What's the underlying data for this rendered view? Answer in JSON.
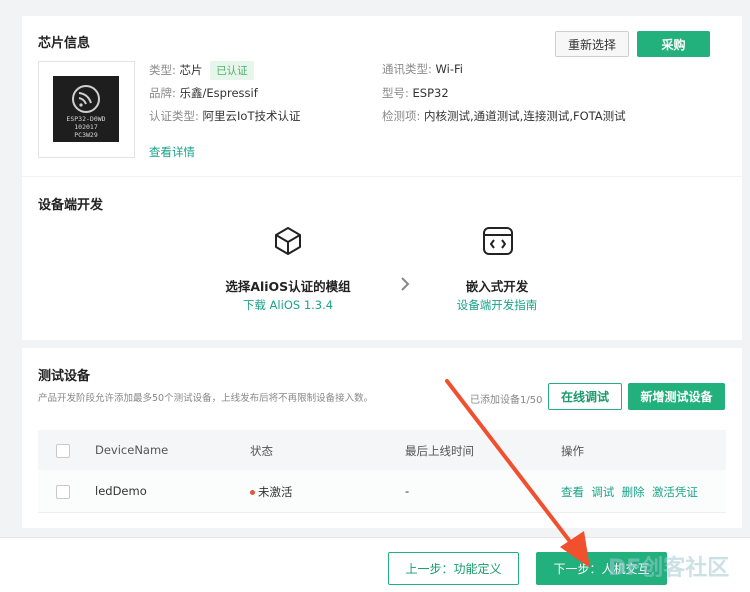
{
  "chip_info": {
    "title": "芯片信息",
    "buttons": {
      "reselect": "重新选择",
      "purchase": "采购"
    },
    "image_label_lines": [
      "ESP32-D0WD",
      "102017",
      "PC3W29"
    ],
    "fields": {
      "type_label": "类型:",
      "type_value": "芯片",
      "certified_badge": "已认证",
      "brand_label": "品牌:",
      "brand_value": "乐鑫/Espressif",
      "cert_type_label": "认证类型:",
      "cert_type_value": "阿里云IoT技术认证",
      "comm_type_label": "通讯类型:",
      "comm_type_value": "Wi-Fi",
      "model_label": "型号:",
      "model_value": "ESP32",
      "test_items_label": "检测项:",
      "test_items_value": "内核测试,通道测试,连接测试,FOTA测试"
    },
    "details_link": "查看详情"
  },
  "device_dev": {
    "title": "设备端开发",
    "step1": {
      "title": "选择AliOS认证的模组",
      "link": "下载 AliOS 1.3.4",
      "icon": "cube-icon"
    },
    "step2": {
      "title": "嵌入式开发",
      "link": "设备端开发指南",
      "icon": "code-window-icon"
    }
  },
  "test_devices": {
    "title": "测试设备",
    "description": "产品开发阶段允许添加最多50个测试设备，上线发布后将不再限制设备接入数。",
    "count_text": "已添加设备1/50",
    "online_debug_button": "在线调试",
    "add_device_button": "新增测试设备",
    "columns": [
      "DeviceName",
      "状态",
      "最后上线时间",
      "操作"
    ],
    "rows": [
      {
        "device_name": "ledDemo",
        "status": "未激活",
        "status_color": "#e8553e",
        "last_online": "-",
        "actions": [
          "查看",
          "调试",
          "删除",
          "激活凭证"
        ]
      }
    ]
  },
  "footer": {
    "prev_button": "上一步：功能定义",
    "next_button": "下一步：人机交互",
    "watermark": "DF创客社区"
  },
  "colors": {
    "accent": "#22b07d",
    "link": "#1aa38a",
    "arrow": "#f0502e"
  }
}
